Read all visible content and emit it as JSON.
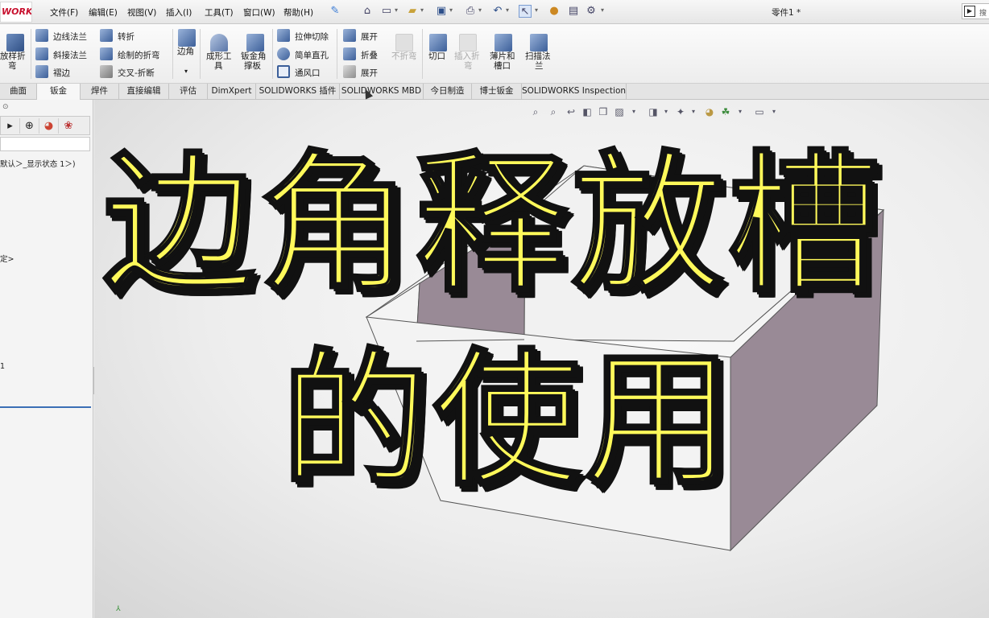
{
  "app": {
    "logo_text": "WORKS",
    "document_title": "零件1 *",
    "search_placeholder": "搜"
  },
  "menu": [
    "文件(F)",
    "编辑(E)",
    "视图(V)",
    "插入(I)",
    "工具(T)",
    "窗口(W)",
    "帮助(H)"
  ],
  "ribbon": {
    "col1": {
      "line1": "放样折",
      "line2": "弯"
    },
    "col2": [
      "边线法兰",
      "斜接法兰",
      "褶边"
    ],
    "col3": [
      "转折",
      "绘制的折弯",
      "交叉-折断"
    ],
    "col4": {
      "label": "边角"
    },
    "col5": {
      "line1": "成形工",
      "line2": "具"
    },
    "col6": {
      "line1": "钣金角",
      "line2": "撑板"
    },
    "col7": [
      "拉伸切除",
      "简单直孔",
      "通风口"
    ],
    "col8": [
      "展开",
      "折叠",
      "展开"
    ],
    "col9": {
      "line1": "不折弯"
    },
    "col10": {
      "line1": "切口"
    },
    "col11": {
      "line1": "插入折",
      "line2": "弯"
    },
    "col12": {
      "line1": "薄片和",
      "line2": "槽口"
    },
    "col13": {
      "line1": "扫描法",
      "line2": "兰"
    }
  },
  "tabs": [
    "曲面",
    "钣金",
    "焊件",
    "直接编辑",
    "评估",
    "DimXpert",
    "SOLIDWORKS 插件",
    "SOLIDWORKS MBD",
    "今日制造",
    "博士钣金",
    "SOLIDWORKS Inspection"
  ],
  "active_tab": "钣金",
  "left_panel": {
    "tree_line1": "默认＞_显示状态 1＞)",
    "tree_line2": "定>",
    "tree_line3": "1"
  },
  "overlay": {
    "line1": "边角释放槽",
    "line2": "的使用"
  },
  "colors": {
    "title_yellow": "#fff95a",
    "model_face": "#998a96",
    "model_light": "#f3f3f3"
  }
}
